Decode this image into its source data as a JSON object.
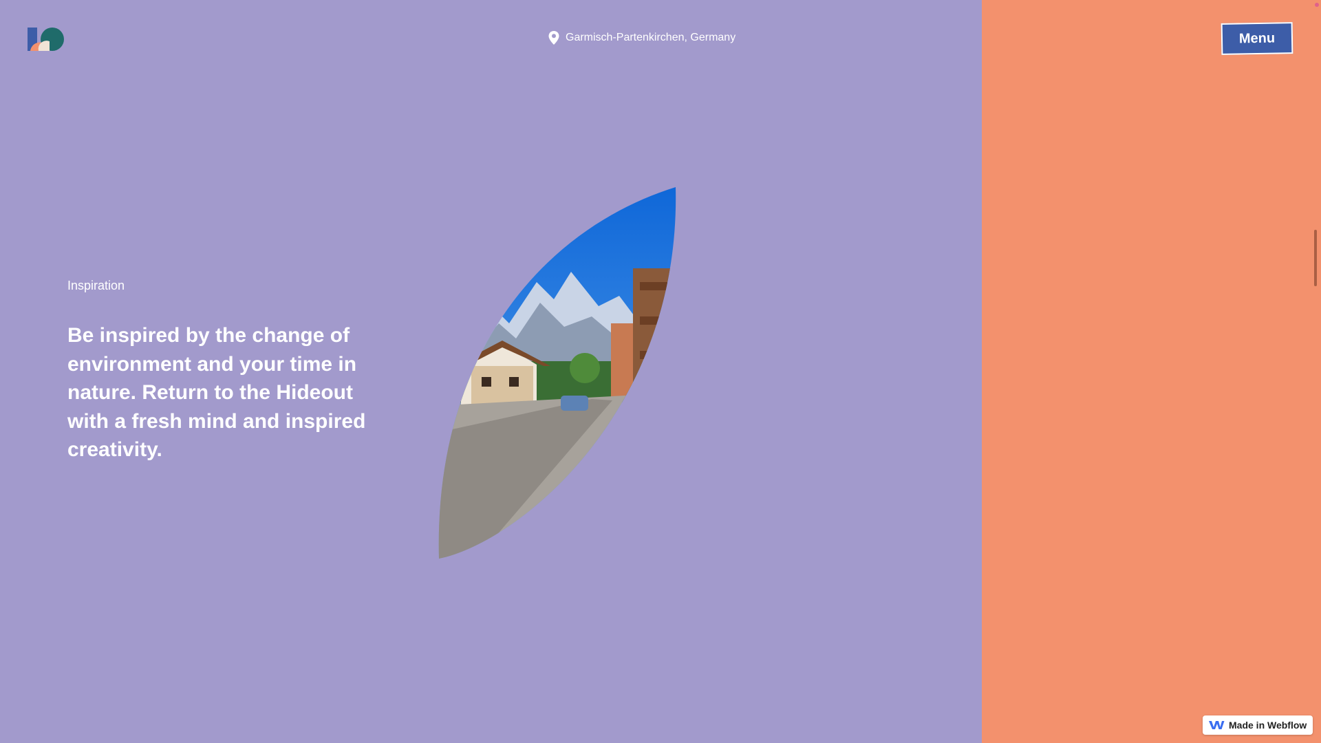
{
  "header": {
    "logo_name": "hideout-logo",
    "location": "Garmisch-Partenkirchen, Germany",
    "menu_label": "Menu"
  },
  "hero": {
    "eyebrow": "Inspiration",
    "headline": "Be inspired by the change of environment and your time in nature. Return to the Hideout with a fresh mind and inspired creativity."
  },
  "badge": {
    "label": "Made in Webflow",
    "icon": "webflow-icon"
  },
  "colors": {
    "left_panel": "#a29acc",
    "right_panel": "#f3916d",
    "menu_button": "#3d5da8"
  }
}
